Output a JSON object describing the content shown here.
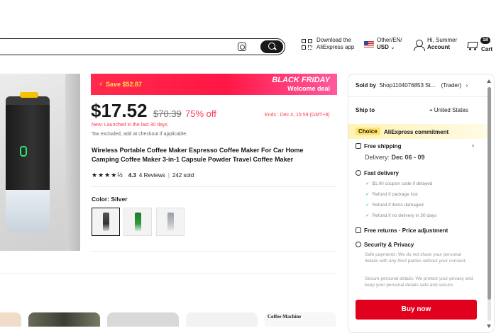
{
  "header": {
    "app_text_line1": "Download the",
    "app_text_line2": "AliExpress app",
    "locale_line1": "Other/EN/",
    "locale_line2": "USD",
    "account_line1": "Hi, Summer",
    "account_line2": "Account",
    "cart_badge": "18",
    "cart_label": "Cart"
  },
  "banner": {
    "save": "Save $52.87",
    "event_line1": "BLACK FRIDAY",
    "event_line2": "Welcome deal"
  },
  "product": {
    "price": "$17.52",
    "old_price": "$70.39",
    "discount": "75% off",
    "ends": "Ends : Dec 4, 15:59 (GMT+8)",
    "launched": "New: Launched in the last 30 days",
    "tax": "Tax excluded, add at checkout if applicable.",
    "title": "Wireless Portable Coffee Maker Espresso Coffee Maker For Car Home Camping Coffee Maker 3-in-1 Capsule Powder Travel Coffee Maker",
    "stars": "★★★★½",
    "rating": "4.3",
    "reviews": "4 Reviews",
    "sold": "242 sold",
    "color_label": "Color: Silver"
  },
  "panel": {
    "sold_by_label": "Sold by",
    "sold_by_value": "Shop1104076853 St...",
    "trader": "(Trader)",
    "ship_to_label": "Ship to",
    "ship_to_value": "United States",
    "choice_tag": "Choice",
    "choice_text": "AliExpress commitment",
    "free_shipping": "Free shipping",
    "delivery_label": "Delivery:",
    "delivery_value": "Dec 06 - 09",
    "fast_delivery": "Fast delivery",
    "fast_items": [
      "$1.00 coupon code if delayed",
      "Refund if package lost",
      "Refund if items damaged",
      "Refund if no delivery in 30 days"
    ],
    "free_returns": "Free returns · Price adjustment",
    "security": "Security & Privacy",
    "security_text1": "Safe payments: We do not share your personal details with any third parties without your consent.",
    "security_text2": "Secure personal details: We protect your privacy and keep your personal details safe and secure.",
    "buy_now": "Buy now"
  },
  "recommendations": {
    "label": "Coffee Machine"
  },
  "colors": {
    "brand_red": "#fd384f",
    "buy_red": "#e1001e",
    "choice_yellow": "#ffe36a"
  }
}
